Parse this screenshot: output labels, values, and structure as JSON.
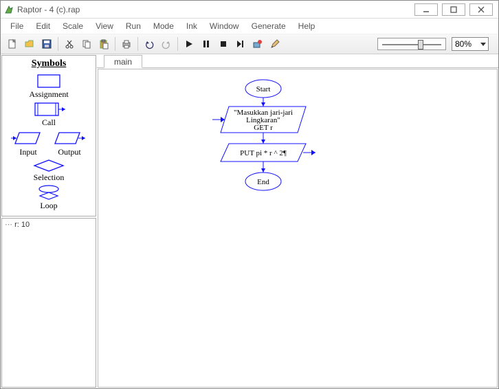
{
  "window": {
    "title": "Raptor - 4 (c).rap"
  },
  "menu": {
    "items": [
      "File",
      "Edit",
      "Scale",
      "View",
      "Run",
      "Mode",
      "Ink",
      "Window",
      "Generate",
      "Help"
    ]
  },
  "toolbar": {
    "zoom_value": "80%"
  },
  "symbols": {
    "title": "Symbols",
    "assignment": "Assignment",
    "call": "Call",
    "input": "Input",
    "output": "Output",
    "selection": "Selection",
    "loop": "Loop"
  },
  "variables": {
    "line1": "r: 10"
  },
  "tabs": {
    "main": "main"
  },
  "flowchart": {
    "start": "Start",
    "input_l1": "\"Masukkan jari-jari",
    "input_l2": "Lingkaran\"",
    "input_l3": "GET r",
    "output_l1": "PUT pi * r ^ 2¶",
    "end": "End"
  }
}
